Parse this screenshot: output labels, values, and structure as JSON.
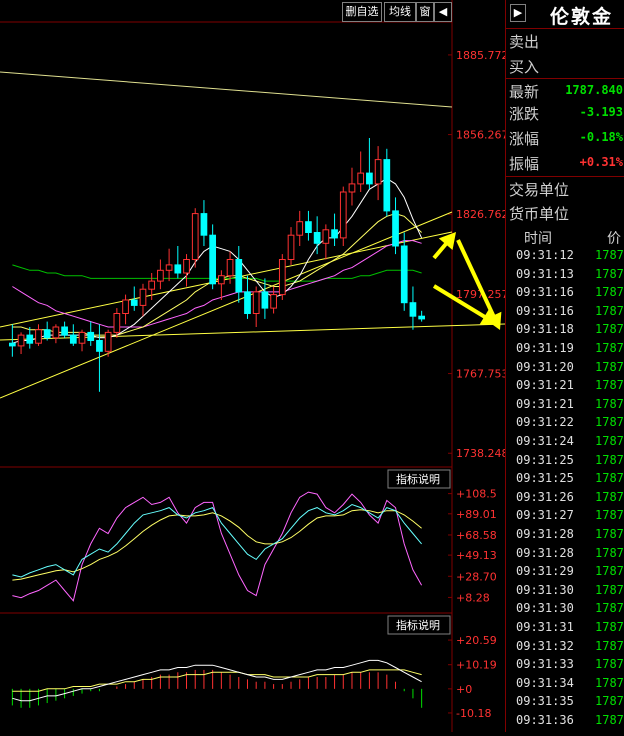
{
  "toolbar": {
    "btn1": "删自选",
    "btn2": "均线",
    "btn3": "窗",
    "btn4": "◀"
  },
  "panel": {
    "title": "伦敦金",
    "collapse_icon": "▶",
    "rows": [
      {
        "label": "卖出",
        "value": ""
      },
      {
        "label": "买入",
        "value": ""
      },
      {
        "label": "最新",
        "value": "1787.840"
      },
      {
        "label": "涨跌",
        "value": "-3.193"
      },
      {
        "label": "涨幅",
        "value": "-0.18%"
      },
      {
        "label": "振幅",
        "value": "+0.31%"
      },
      {
        "label": "交易单位",
        "value": ""
      },
      {
        "label": "货币单位",
        "value": ""
      }
    ],
    "ticks_header": {
      "time": "时间",
      "price": "价"
    },
    "ticks": [
      {
        "time": "09:31:12",
        "price": "1787."
      },
      {
        "time": "09:31:13",
        "price": "1787."
      },
      {
        "time": "09:31:16",
        "price": "1787."
      },
      {
        "time": "09:31:16",
        "price": "1787."
      },
      {
        "time": "09:31:18",
        "price": "1787."
      },
      {
        "time": "09:31:19",
        "price": "1787."
      },
      {
        "time": "09:31:20",
        "price": "1787."
      },
      {
        "time": "09:31:21",
        "price": "1787."
      },
      {
        "time": "09:31:21",
        "price": "1787."
      },
      {
        "time": "09:31:22",
        "price": "1787."
      },
      {
        "time": "09:31:24",
        "price": "1787."
      },
      {
        "time": "09:31:25",
        "price": "1787."
      },
      {
        "time": "09:31:25",
        "price": "1787."
      },
      {
        "time": "09:31:26",
        "price": "1787."
      },
      {
        "time": "09:31:27",
        "price": "1787."
      },
      {
        "time": "09:31:28",
        "price": "1787."
      },
      {
        "time": "09:31:28",
        "price": "1787."
      },
      {
        "time": "09:31:29",
        "price": "1787."
      },
      {
        "time": "09:31:30",
        "price": "1787."
      },
      {
        "time": "09:31:30",
        "price": "1787."
      },
      {
        "time": "09:31:31",
        "price": "1787."
      },
      {
        "time": "09:31:32",
        "price": "1787."
      },
      {
        "time": "09:31:33",
        "price": "1787."
      },
      {
        "time": "09:31:34",
        "price": "1787."
      },
      {
        "time": "09:31:35",
        "price": "1787."
      },
      {
        "time": "09:31:36",
        "price": "1787."
      }
    ]
  },
  "colors": {
    "up": "#ff3232",
    "down": "#00ffff",
    "grid": "#800000",
    "axis_text": "#ff3232",
    "ma1": "#ffffff",
    "ma2": "#ffff00",
    "ma3": "#ff66ff",
    "ma4": "#00c000",
    "trend": "#ffff44"
  },
  "chart_data": [
    {
      "type": "candlestick",
      "y_ticks": [
        "1885.772",
        "1856.267",
        "1826.762",
        "1797.257",
        "1767.753",
        "1738.248"
      ],
      "y_tick_values": [
        1885.772,
        1856.267,
        1826.762,
        1797.257,
        1767.753,
        1738.248
      ],
      "ylim": [
        1735,
        1895
      ],
      "last_price": 1787.84,
      "candles": [
        [
          1779,
          1786,
          1774,
          1778
        ],
        [
          1778,
          1783,
          1775,
          1782
        ],
        [
          1782,
          1785,
          1777,
          1779
        ],
        [
          1779,
          1786,
          1778,
          1784
        ],
        [
          1784,
          1787,
          1780,
          1781
        ],
        [
          1781,
          1786,
          1779,
          1785
        ],
        [
          1785,
          1787,
          1781,
          1782
        ],
        [
          1782,
          1786,
          1778,
          1779
        ],
        [
          1779,
          1784,
          1776,
          1783
        ],
        [
          1783,
          1787,
          1778,
          1780
        ],
        [
          1780,
          1786,
          1761,
          1776
        ],
        [
          1776,
          1784,
          1774,
          1783
        ],
        [
          1783,
          1792,
          1781,
          1790
        ],
        [
          1790,
          1797,
          1786,
          1795
        ],
        [
          1795,
          1800,
          1791,
          1793
        ],
        [
          1793,
          1801,
          1789,
          1799
        ],
        [
          1799,
          1805,
          1795,
          1802
        ],
        [
          1802,
          1810,
          1799,
          1806
        ],
        [
          1806,
          1814,
          1802,
          1808
        ],
        [
          1808,
          1815,
          1803,
          1805
        ],
        [
          1805,
          1812,
          1800,
          1810
        ],
        [
          1810,
          1829,
          1807,
          1827
        ],
        [
          1827,
          1832,
          1815,
          1819
        ],
        [
          1819,
          1823,
          1799,
          1801
        ],
        [
          1801,
          1806,
          1795,
          1804
        ],
        [
          1804,
          1813,
          1801,
          1810
        ],
        [
          1810,
          1815,
          1794,
          1798
        ],
        [
          1798,
          1804,
          1788,
          1790
        ],
        [
          1790,
          1800,
          1785,
          1798
        ],
        [
          1798,
          1803,
          1788,
          1792
        ],
        [
          1792,
          1800,
          1790,
          1797
        ],
        [
          1797,
          1812,
          1795,
          1810
        ],
        [
          1810,
          1822,
          1808,
          1819
        ],
        [
          1819,
          1828,
          1815,
          1824
        ],
        [
          1824,
          1828,
          1817,
          1820
        ],
        [
          1820,
          1826,
          1812,
          1816
        ],
        [
          1816,
          1823,
          1810,
          1821
        ],
        [
          1821,
          1827,
          1815,
          1818
        ],
        [
          1818,
          1837,
          1815,
          1835
        ],
        [
          1835,
          1844,
          1830,
          1838
        ],
        [
          1838,
          1850,
          1835,
          1842
        ],
        [
          1842,
          1855,
          1836,
          1838
        ],
        [
          1838,
          1852,
          1832,
          1847
        ],
        [
          1847,
          1851,
          1826,
          1828
        ],
        [
          1828,
          1833,
          1812,
          1815
        ],
        [
          1815,
          1820,
          1791,
          1794
        ],
        [
          1794,
          1800,
          1784,
          1789
        ],
        [
          1789,
          1791,
          1787,
          1788
        ]
      ],
      "ma_short": [
        1779,
        1780,
        1780,
        1781,
        1782,
        1782,
        1782,
        1782,
        1782,
        1782,
        1781,
        1781,
        1782,
        1784,
        1786,
        1789,
        1792,
        1795,
        1798,
        1801,
        1804,
        1809,
        1813,
        1815,
        1814,
        1813,
        1810,
        1806,
        1802,
        1798,
        1796,
        1797,
        1800,
        1804,
        1810,
        1815,
        1818,
        1818,
        1822,
        1826,
        1831,
        1836,
        1838,
        1840,
        1838,
        1833,
        1825,
        1818
      ],
      "ma_mid": [
        1785,
        1785,
        1784,
        1784,
        1784,
        1783,
        1783,
        1783,
        1783,
        1782,
        1782,
        1782,
        1782,
        1783,
        1784,
        1785,
        1787,
        1789,
        1791,
        1793,
        1795,
        1798,
        1800,
        1802,
        1803,
        1804,
        1804,
        1803,
        1802,
        1801,
        1800,
        1800,
        1801,
        1802,
        1804,
        1806,
        1808,
        1810,
        1812,
        1815,
        1818,
        1821,
        1824,
        1826,
        1827,
        1826,
        1823,
        1820
      ],
      "ma_long": [
        1800,
        1798,
        1796,
        1794,
        1793,
        1791,
        1790,
        1789,
        1788,
        1787,
        1786,
        1785,
        1785,
        1785,
        1785,
        1785,
        1786,
        1787,
        1788,
        1789,
        1790,
        1792,
        1793,
        1795,
        1796,
        1797,
        1798,
        1798,
        1798,
        1798,
        1798,
        1798,
        1799,
        1800,
        1801,
        1802,
        1803,
        1804,
        1806,
        1807,
        1809,
        1811,
        1813,
        1815,
        1816,
        1817,
        1817,
        1816
      ],
      "ma_xlong": [
        1808,
        1807,
        1806,
        1806,
        1805,
        1805,
        1804,
        1804,
        1804,
        1803,
        1803,
        1803,
        1803,
        1803,
        1803,
        1803,
        1803,
        1803,
        1803,
        1803,
        1803,
        1803,
        1803,
        1803,
        1803,
        1803,
        1803,
        1803,
        1803,
        1802,
        1802,
        1802,
        1802,
        1802,
        1802,
        1802,
        1803,
        1803,
        1803,
        1803,
        1804,
        1804,
        1805,
        1806,
        1806,
        1806,
        1806,
        1805
      ]
    },
    {
      "type": "line",
      "panel_button": "指标说明",
      "y_ticks": [
        "+108.5",
        "+89.01",
        "+68.58",
        "+49.13",
        "+28.70",
        "+8.28"
      ],
      "y_tick_values": [
        108.5,
        89.01,
        68.58,
        49.13,
        28.7,
        8.28
      ],
      "ylim": [
        0,
        112
      ],
      "k": [
        30,
        28,
        32,
        35,
        38,
        40,
        35,
        30,
        45,
        50,
        55,
        52,
        60,
        70,
        80,
        88,
        90,
        92,
        95,
        88,
        85,
        90,
        92,
        95,
        80,
        70,
        60,
        50,
        45,
        55,
        60,
        65,
        75,
        85,
        92,
        95,
        90,
        88,
        92,
        98,
        95,
        90,
        85,
        95,
        92,
        80,
        70,
        60
      ],
      "d": [
        25,
        26,
        28,
        30,
        32,
        34,
        35,
        33,
        36,
        40,
        45,
        48,
        52,
        58,
        65,
        72,
        78,
        83,
        87,
        88,
        87,
        87,
        88,
        90,
        87,
        82,
        76,
        68,
        62,
        60,
        60,
        62,
        66,
        72,
        79,
        85,
        87,
        87,
        88,
        92,
        93,
        92,
        90,
        92,
        92,
        88,
        82,
        75
      ],
      "j": [
        10,
        8,
        12,
        15,
        20,
        25,
        15,
        5,
        40,
        60,
        75,
        70,
        85,
        95,
        100,
        105,
        98,
        100,
        105,
        90,
        80,
        95,
        100,
        100,
        70,
        50,
        30,
        15,
        10,
        40,
        55,
        70,
        90,
        105,
        110,
        108,
        95,
        90,
        98,
        108,
        100,
        88,
        80,
        102,
        95,
        60,
        35,
        20
      ]
    },
    {
      "type": "bar",
      "panel_button": "指标说明",
      "y_ticks": [
        "+20.59",
        "+10.19",
        "+0",
        "-10.18"
      ],
      "y_tick_values": [
        20.59,
        10.19,
        0,
        -10.18
      ],
      "ylim": [
        -14,
        24
      ],
      "macd": [
        -7,
        -8,
        -8,
        -7,
        -6,
        -5,
        -4,
        -3,
        -2,
        -1,
        -1,
        0,
        1,
        2,
        3,
        4,
        5,
        6,
        6,
        7,
        7,
        8,
        8,
        8,
        7,
        6,
        5,
        4,
        3,
        3,
        2,
        2,
        3,
        4,
        5,
        5,
        5,
        6,
        6,
        7,
        7,
        7,
        7,
        6,
        3,
        -1,
        -4,
        -8
      ],
      "dif": [
        -4,
        -5,
        -5,
        -4,
        -3,
        -3,
        -2,
        -1,
        0,
        0,
        1,
        2,
        3,
        4,
        5,
        6,
        7,
        8,
        8,
        9,
        9,
        10,
        10,
        10,
        9,
        8,
        7,
        6,
        5,
        5,
        4,
        4,
        5,
        6,
        7,
        8,
        8,
        9,
        9,
        10,
        11,
        12,
        12,
        11,
        9,
        7,
        5,
        3
      ],
      "dea": [
        -1,
        -1,
        -1,
        -1,
        0,
        0,
        0,
        1,
        1,
        1,
        2,
        2,
        2,
        3,
        3,
        4,
        4,
        5,
        5,
        5,
        6,
        6,
        6,
        7,
        7,
        7,
        7,
        6,
        6,
        6,
        5,
        5,
        5,
        5,
        5,
        6,
        6,
        6,
        6,
        7,
        7,
        8,
        8,
        8,
        8,
        8,
        7,
        6
      ]
    }
  ]
}
